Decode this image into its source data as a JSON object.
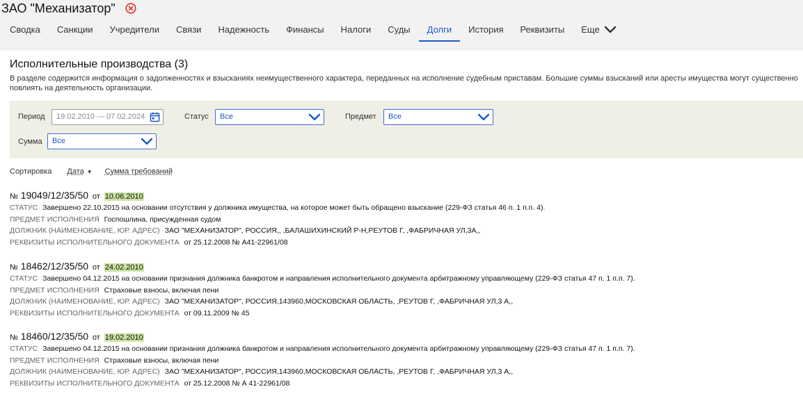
{
  "header": {
    "company": "ЗАО \"Механизатор\"",
    "tabs": [
      {
        "label": "Сводка",
        "active": false
      },
      {
        "label": "Санкции",
        "active": false
      },
      {
        "label": "Учредители",
        "active": false
      },
      {
        "label": "Связи",
        "active": false
      },
      {
        "label": "Надежность",
        "active": false
      },
      {
        "label": "Финансы",
        "active": false
      },
      {
        "label": "Налоги",
        "active": false
      },
      {
        "label": "Суды",
        "active": false
      },
      {
        "label": "Долги",
        "active": true
      },
      {
        "label": "История",
        "active": false
      },
      {
        "label": "Реквизиты",
        "active": false
      }
    ],
    "more_label": "Еще"
  },
  "section": {
    "title": "Исполнительные производства (3)",
    "description": "В разделе содержится информация о задолженностях и взысканиях неимущественного характера, переданных на исполнение судебным приставам. Большие суммы взысканий или аресты имущества могут существенно повлиять на деятельность организации."
  },
  "filters": {
    "period_label": "Период",
    "period_value": "19.02.2010 — 07.02.2024",
    "status_label": "Статус",
    "status_value": "Все",
    "subject_label": "Предмет",
    "subject_value": "Все",
    "amount_label": "Сумма",
    "amount_value": "Все"
  },
  "sorting": {
    "label": "Сортировка",
    "by_date": "Дата",
    "by_amount": "Сумма требований"
  },
  "records": [
    {
      "no_prefix": "№",
      "number": "19049/12/35/50",
      "ot": "от",
      "date": "10.06.2010",
      "status_key": "Статус",
      "status": "Завершено 22.10.2015 на основании отсутствия у должника имущества, на которое может быть обращено взыскание (229-ФЗ статья 46 п. 1 п.п. 4).",
      "subject_key": "Предмет исполнения",
      "subject": "Госпошлина, присужденная судом",
      "debtor_key": "Должник (наименование, юр. адрес)",
      "debtor": "ЗАО \"МЕХАНИЗАТОР\", РОССИЯ,, ,БАЛАШИХИНСКИЙ Р-Н,РЕУТОВ Г, ,ФАБРИЧНАЯ УЛ,3А,,",
      "doc_key": "Реквизиты исполнительного документа",
      "doc": "от 25.12.2008 № А41-22961/08"
    },
    {
      "no_prefix": "№",
      "number": "18462/12/35/50",
      "ot": "от",
      "date": "24.02.2010",
      "status_key": "Статус",
      "status": "Завершено 04.12.2015 на основании признания должника банкротом и направления исполнительного документа арбитражному управляющему (229-ФЗ статья 47 п. 1 п.п. 7).",
      "subject_key": "Предмет исполнения",
      "subject": "Страховые взносы, включая пени",
      "debtor_key": "Должник (наименование, юр. адрес)",
      "debtor": "ЗАО \"МЕХАНИЗАТОР\", РОССИЯ,143960,МОСКОВСКАЯ ОБЛАСТЬ, ,РЕУТОВ Г, ,ФАБРИЧНАЯ УЛ,3 А,,",
      "doc_key": "Реквизиты исполнительного документа",
      "doc": "от 09.11.2009 № 45"
    },
    {
      "no_prefix": "№",
      "number": "18460/12/35/50",
      "ot": "от",
      "date": "19.02.2010",
      "status_key": "Статус",
      "status": "Завершено 04.12.2015 на основании признания должника банкротом и направления исполнительного документа арбитражному управляющему (229-ФЗ статья 47 п. 1 п.п. 7).",
      "subject_key": "Предмет исполнения",
      "subject": "Страховые взносы, включая пени",
      "debtor_key": "Должник (наименование, юр. адрес)",
      "debtor": "ЗАО \"МЕХАНИЗАТОР\", РОССИЯ,143960,МОСКОВСКАЯ ОБЛАСТЬ, ,РЕУТОВ Г, ,ФАБРИЧНАЯ УЛ,3 А,,",
      "doc_key": "Реквизиты исполнительного документа",
      "doc": "от 25.12.2008 № А 41-22961/08"
    }
  ],
  "colors": {
    "accent": "#1a56c9",
    "close_icon": "#e0302a",
    "filter_bg": "#efefe5",
    "date_highlight": "#c9e3a2"
  },
  "icons": {
    "close": "close-circle-icon",
    "more": "chevron-down-icon",
    "calendar": "calendar-icon",
    "dropdown": "chevron-down-icon",
    "sort": "caret-down-icon"
  }
}
